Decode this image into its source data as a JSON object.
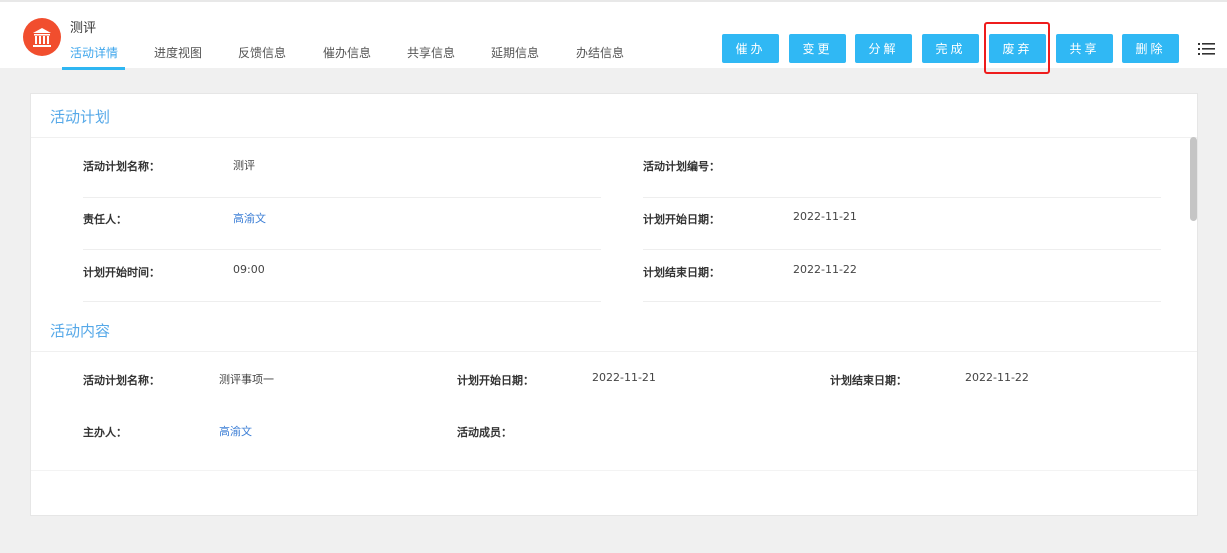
{
  "header": {
    "title": "测评",
    "logo_icon": "bank-icon",
    "tabs": [
      "活动详情",
      "进度视图",
      "反馈信息",
      "催办信息",
      "共享信息",
      "延期信息",
      "办结信息"
    ],
    "active_tab": 0,
    "buttons": [
      "催办",
      "变更",
      "分解",
      "完成",
      "废弃",
      "共享",
      "删除"
    ],
    "highlighted_button": "废弃",
    "menu_icon": "list-icon"
  },
  "plan": {
    "title": "活动计划",
    "rows": [
      [
        {
          "label": "活动计划名称：",
          "value": "测评"
        },
        {
          "label": "活动计划编号：",
          "value": ""
        }
      ],
      [
        {
          "label": "责任人：",
          "value": "高渝文"
        },
        {
          "label": "计划开始日期：",
          "value": "2022-11-21"
        }
      ],
      [
        {
          "label": "计划开始时间：",
          "value": "09:00"
        },
        {
          "label": "计划结束日期：",
          "value": "2022-11-22"
        }
      ]
    ]
  },
  "content": {
    "title": "活动内容",
    "rows": [
      [
        {
          "label": "活动计划名称：",
          "value": "测评事项一"
        },
        {
          "label": "计划开始日期：",
          "value": "2022-11-21"
        },
        {
          "label": "计划结束日期：",
          "value": "2022-11-22"
        }
      ],
      [
        {
          "label": "主办人：",
          "value": "高渝文"
        },
        {
          "label": "活动成员：",
          "value": ""
        }
      ]
    ]
  },
  "colors": {
    "accent": "#30b8f4",
    "highlight": "#ee1c1c",
    "logo": "#f14e2e"
  }
}
